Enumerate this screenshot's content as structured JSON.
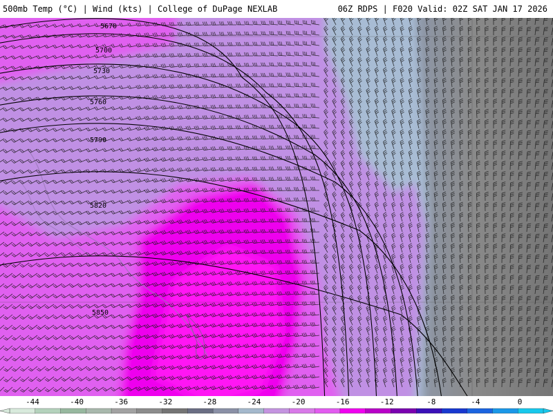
{
  "header": {
    "left_title": "500mb Temp (°C) | Wind (kts) | College of DuPage NEXLAB",
    "right_title": "06Z RDPS | F020 Valid: 02Z SAT JAN 17 2026"
  },
  "contours": {
    "labels": [
      "5670",
      "5700",
      "5730",
      "5760",
      "5790",
      "5820",
      "5850"
    ]
  },
  "colorbar": {
    "tick_labels": [
      "-44",
      "-40",
      "-36",
      "-32",
      "-28",
      "-24",
      "-20",
      "-16",
      "-12",
      "-8",
      "-4",
      "0"
    ],
    "colors": [
      "#d8eadc",
      "#b4d2bc",
      "#97b89f",
      "#a8b8ac",
      "#a2a2a2",
      "#8c8c8c",
      "#747474",
      "#6a6e84",
      "#8a90a6",
      "#a4b8cc",
      "#c494e0",
      "#d87ae8",
      "#e25cf0",
      "#f000f0",
      "#b800c8",
      "#7a00b0",
      "#3a10b8",
      "#1838d0",
      "#1a64e0",
      "#1a98e8",
      "#18c8ec"
    ]
  },
  "palette": {
    "magenta": "#ee00ee",
    "light_magenta": "#e060f0",
    "lavender": "#c090e4",
    "light_blue": "#a8bcd4",
    "blue_grey": "#8e98aa",
    "grey": "#8a8a8a",
    "dark_grey": "#6e6e6e"
  }
}
